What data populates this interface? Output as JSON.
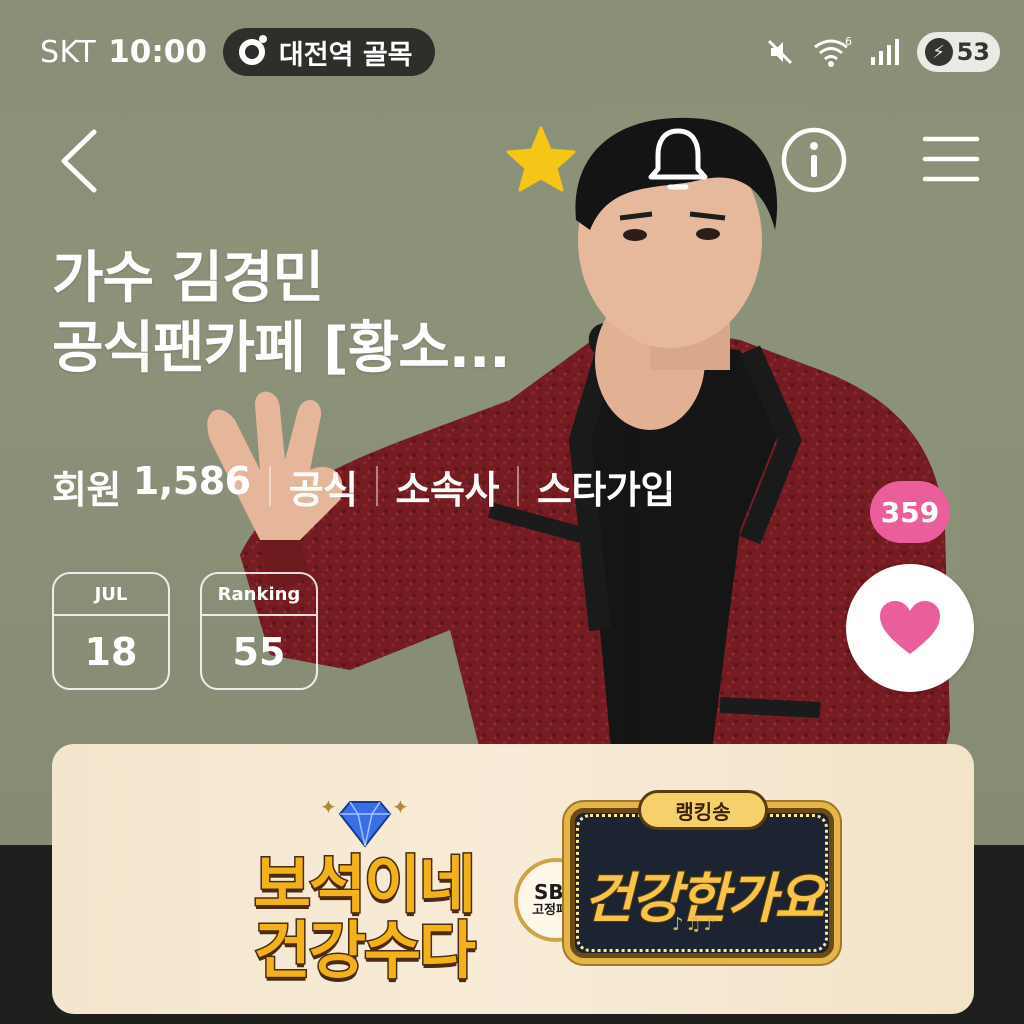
{
  "status_bar": {
    "carrier": "SKT",
    "time": "10:00",
    "location": "대전역 골목",
    "wifi_badge": "6",
    "battery": "53",
    "icons": [
      "mute-icon",
      "wifi-icon",
      "signal-icon",
      "charging-icon"
    ]
  },
  "nav": {
    "icons": [
      "back-icon",
      "star-icon",
      "bell-icon",
      "info-icon",
      "menu-icon"
    ],
    "star_color": "#f5c518"
  },
  "cafe": {
    "title_line1": "가수 김경민",
    "title_line2": "공식팬카페 [황소...",
    "members_label": "회원",
    "members_count": "1,586",
    "tag_official": "공식",
    "tag_agency": "소속사",
    "tag_star": "스타가입"
  },
  "date_card": {
    "month": "JUL",
    "day": "18"
  },
  "ranking_card": {
    "label": "Ranking",
    "value": "55"
  },
  "like": {
    "count": "359",
    "color": "#ea5f9b"
  },
  "banner": {
    "left_title_line1": "보석이네",
    "left_title_line2": "건강수다",
    "badge_line1": "SBS",
    "badge_line2": "고정패널",
    "ranking_pill": "랭킹송",
    "right_title": "건강한가요"
  }
}
